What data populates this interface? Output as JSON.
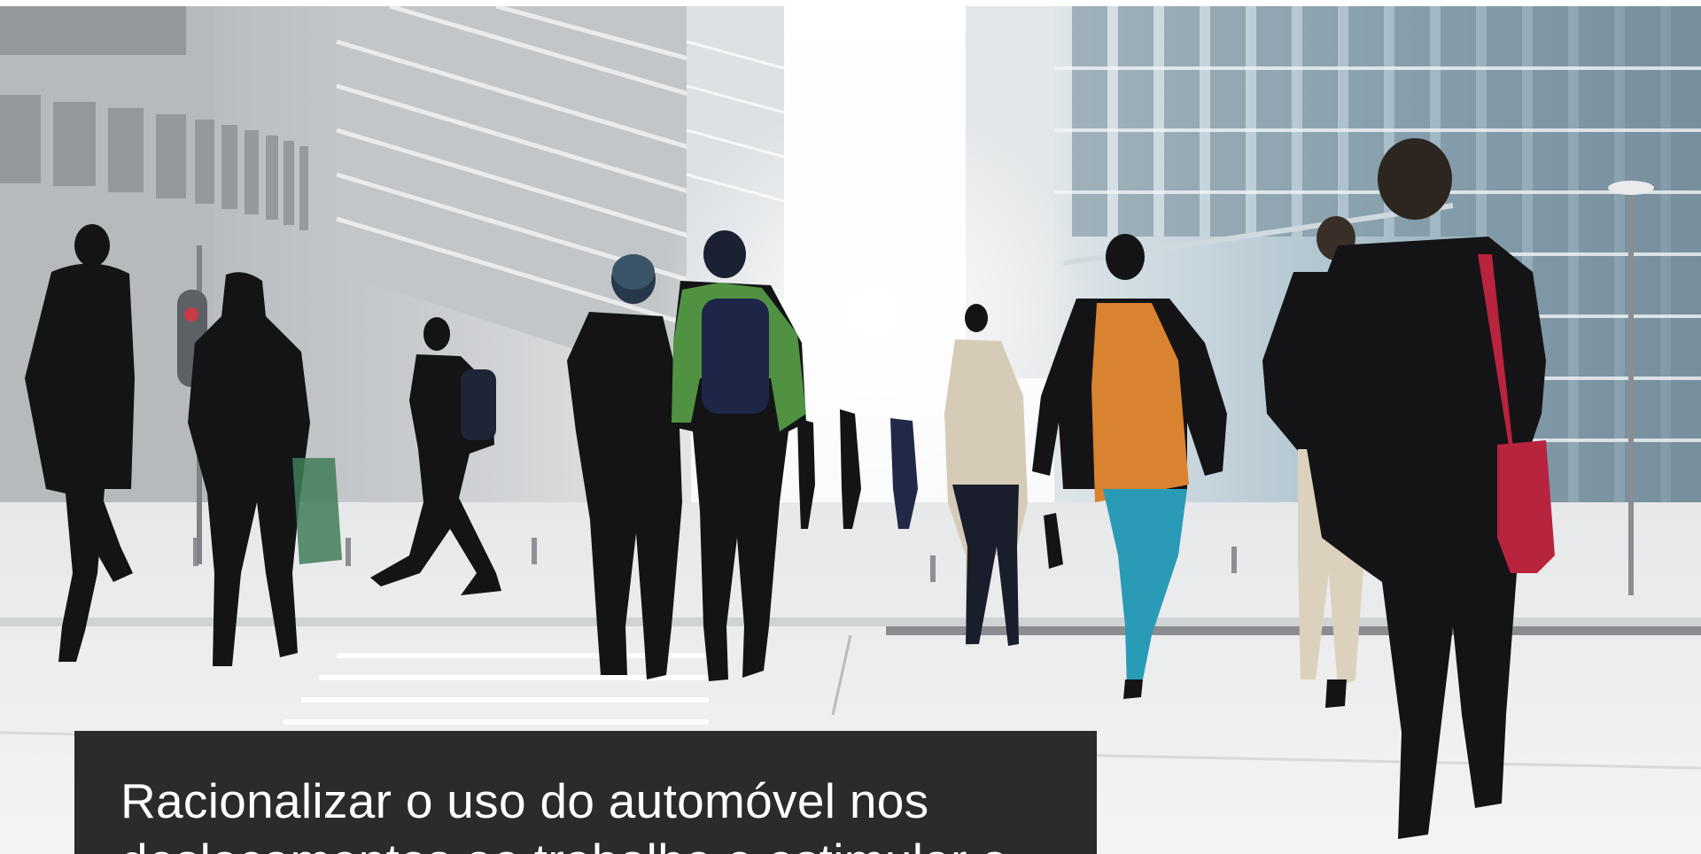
{
  "hero": {
    "image_description_icon": "city-street-pedestrians-photo"
  },
  "caption": {
    "text": "Racionalizar o uso do automóvel nos deslocamentos ao trabalho e estimular a"
  },
  "colors": {
    "caption_background": "#2b2b2b",
    "caption_text": "#ffffff",
    "silhouette": "#141416",
    "orange_shirt": "#d9822f",
    "teal_jeans": "#2a9bb6",
    "green_jacket": "#5aa84a",
    "red_bag": "#b8233e"
  }
}
